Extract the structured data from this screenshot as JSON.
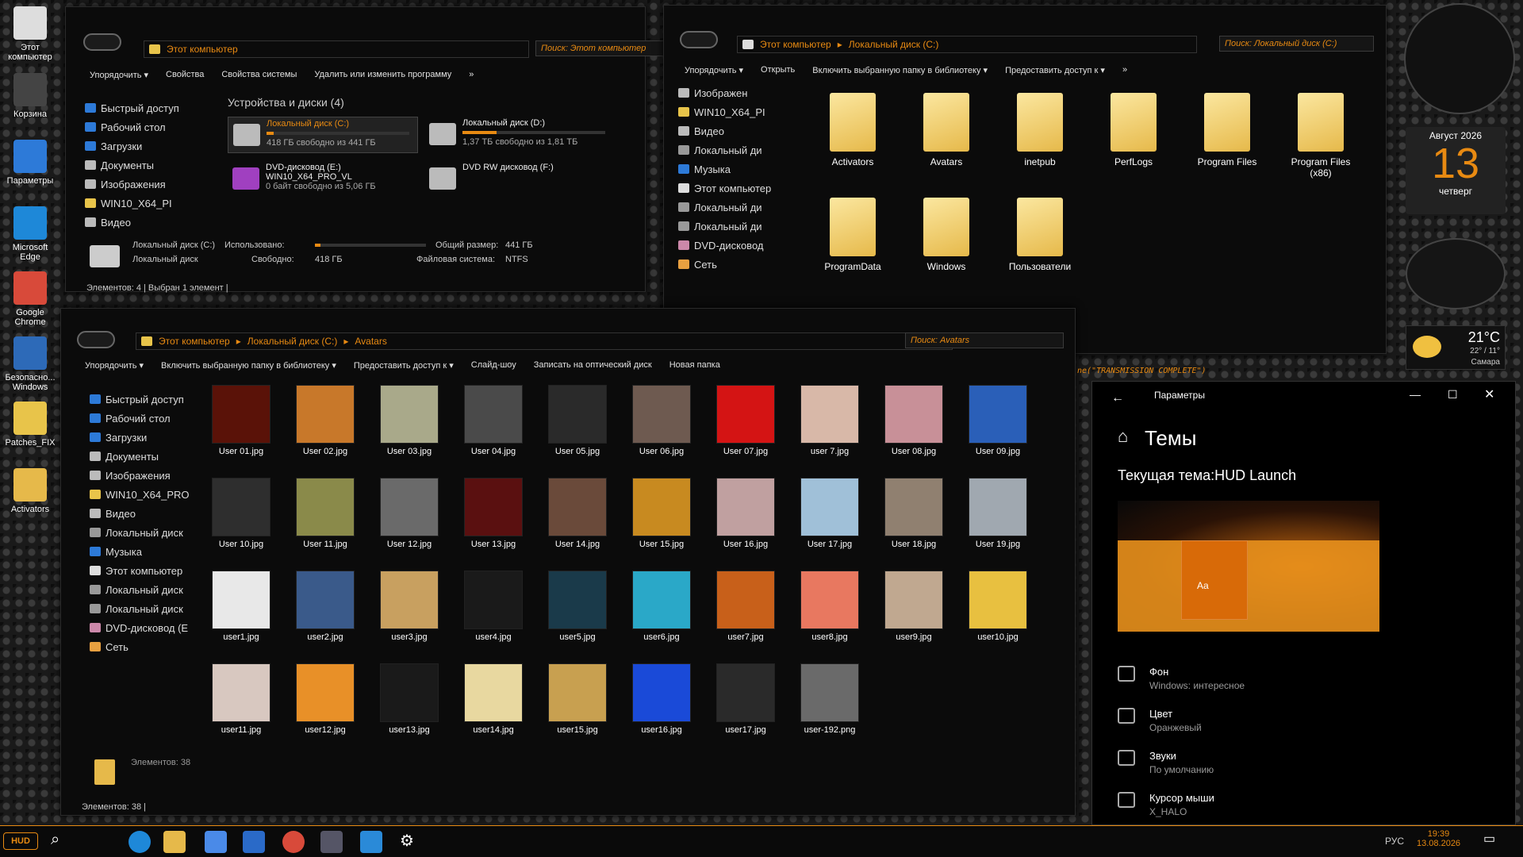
{
  "desktop_icons": [
    {
      "label": "Этот компьютер",
      "icon": "computer-icon"
    },
    {
      "label": "Корзина",
      "icon": "recycle-bin-icon"
    },
    {
      "label": "Параметры",
      "icon": "gear-icon"
    },
    {
      "label": "Microsoft Edge",
      "icon": "edge-icon"
    },
    {
      "label": "Google Chrome",
      "icon": "chrome-icon"
    },
    {
      "label": "Безопасно... Windows",
      "icon": "shield-icon"
    },
    {
      "label": "Patches_FIX",
      "icon": "folder-icon"
    },
    {
      "label": "Activators",
      "icon": "key-folder-icon"
    }
  ],
  "win1": {
    "breadcrumb": [
      "Этот компьютер"
    ],
    "search": "Поиск: Этот компьютер",
    "toolbar": [
      "Упорядочить ▾",
      "Свойства",
      "Свойства системы",
      "Удалить или изменить программу",
      "»"
    ],
    "nav": [
      {
        "label": "Быстрый доступ",
        "icon": "star-icon"
      },
      {
        "label": "Рабочий стол",
        "icon": "desktop-icon"
      },
      {
        "label": "Загрузки",
        "icon": "download-icon"
      },
      {
        "label": "Документы",
        "icon": "documents-icon"
      },
      {
        "label": "Изображения",
        "icon": "pictures-icon"
      },
      {
        "label": "WIN10_X64_PI",
        "icon": "folder-icon"
      },
      {
        "label": "Видео",
        "icon": "video-icon"
      }
    ],
    "group_title": "Устройства и диски (4)",
    "drives": [
      {
        "name": "Локальный диск (C:)",
        "free": "418 ГБ свободно из 441 ГБ",
        "used_fraction": 0.05,
        "selected": true
      },
      {
        "name": "Локальный диск (D:)",
        "free": "1,37 ТБ свободно из 1,81 ТБ",
        "used_fraction": 0.24
      },
      {
        "name": "DVD-дисковод (E:) WIN10_X64_PRO_VL",
        "free": "0 байт свободно из 5,06 ГБ"
      },
      {
        "name": "DVD RW дисковод (F:)",
        "free": ""
      }
    ],
    "details": {
      "name": "Локальный диск (C:)",
      "used_label": "Использовано:",
      "type": "Локальный диск",
      "free_label": "Свободно:",
      "free": "418 ГБ",
      "total_label": "Общий размер:",
      "total": "441 ГБ",
      "fs_label": "Файловая система:",
      "fs": "NTFS"
    },
    "status": "Элементов: 4  |  Выбран 1 элемент  |"
  },
  "win2": {
    "breadcrumb": [
      "Этот компьютер",
      "Локальный диск (C:)"
    ],
    "search": "Поиск: Локальный диск (C:)",
    "toolbar": [
      "Упорядочить ▾",
      "Открыть",
      "Включить выбранную папку в библиотеку ▾",
      "Предоставить доступ к ▾",
      "»"
    ],
    "nav": [
      {
        "label": "Изображен",
        "icon": "pictures-icon"
      },
      {
        "label": "WIN10_X64_PI",
        "icon": "folder-icon"
      },
      {
        "label": "Видео",
        "icon": "video-icon"
      },
      {
        "label": "Локальный ди",
        "icon": "drive-icon"
      },
      {
        "label": "Музыка",
        "icon": "music-icon"
      },
      {
        "label": "Этот компьютер",
        "icon": "computer-icon"
      },
      {
        "label": "Локальный ди",
        "icon": "drive-icon"
      },
      {
        "label": "Локальный ди",
        "icon": "drive-icon"
      },
      {
        "label": "DVD-дисковод",
        "icon": "dvd-icon"
      },
      {
        "label": "Сеть",
        "icon": "network-icon"
      }
    ],
    "folders": [
      "Activators",
      "Avatars",
      "inetpub",
      "PerfLogs",
      "Program Files",
      "Program Files (x86)",
      "ProgramData",
      "Windows",
      "Пользователи"
    ]
  },
  "win3": {
    "breadcrumb": [
      "Этот компьютер",
      "Локальный диск (C:)",
      "Avatars"
    ],
    "search": "Поиск: Avatars",
    "toolbar": [
      "Упорядочить ▾",
      "Включить выбранную папку в библиотеку ▾",
      "Предоставить доступ к ▾",
      "Слайд-шоу",
      "Записать на оптический диск",
      "Новая папка"
    ],
    "nav": [
      {
        "label": "Быстрый доступ",
        "icon": "star-icon"
      },
      {
        "label": "Рабочий стол",
        "icon": "desktop-icon"
      },
      {
        "label": "Загрузки",
        "icon": "download-icon"
      },
      {
        "label": "Документы",
        "icon": "documents-icon"
      },
      {
        "label": "Изображения",
        "icon": "pictures-icon"
      },
      {
        "label": "WIN10_X64_PRO",
        "icon": "folder-icon"
      },
      {
        "label": "Видео",
        "icon": "video-icon"
      },
      {
        "label": "Локальный диск",
        "icon": "drive-icon"
      },
      {
        "label": "Музыка",
        "icon": "music-icon"
      },
      {
        "label": "Этот компьютер",
        "icon": "computer-icon"
      },
      {
        "label": "Локальный диск",
        "icon": "drive-icon"
      },
      {
        "label": "Локальный диск",
        "icon": "drive-icon"
      },
      {
        "label": "DVD-дисковод (E",
        "icon": "dvd-icon"
      },
      {
        "label": "Сеть",
        "icon": "network-icon"
      }
    ],
    "files": [
      {
        "name": "User 01.jpg",
        "color": "#5a1208"
      },
      {
        "name": "User 02.jpg",
        "color": "#c8782a"
      },
      {
        "name": "User 03.jpg",
        "color": "#a9a98a"
      },
      {
        "name": "User 04.jpg",
        "color": "#4a4a4a"
      },
      {
        "name": "User 05.jpg",
        "color": "#2a2a2a"
      },
      {
        "name": "User 06.jpg",
        "color": "#6e5a50"
      },
      {
        "name": "User 07.jpg",
        "color": "#d41414"
      },
      {
        "name": "user 7.jpg",
        "color": "#d8b8a8"
      },
      {
        "name": "User 08.jpg",
        "color": "#c89098"
      },
      {
        "name": "User 09.jpg",
        "color": "#2a5fb8"
      },
      {
        "name": "User 10.jpg",
        "color": "#2e2e2e"
      },
      {
        "name": "User 11.jpg",
        "color": "#8a8a4a"
      },
      {
        "name": "User 12.jpg",
        "color": "#6a6a6a"
      },
      {
        "name": "User 13.jpg",
        "color": "#5a1010"
      },
      {
        "name": "User 14.jpg",
        "color": "#6a4a3a"
      },
      {
        "name": "User 15.jpg",
        "color": "#c88a20"
      },
      {
        "name": "User 16.jpg",
        "color": "#c0a0a0"
      },
      {
        "name": "User 17.jpg",
        "color": "#a0c0d8"
      },
      {
        "name": "User 18.jpg",
        "color": "#908070"
      },
      {
        "name": "User 19.jpg",
        "color": "#a0a8b0"
      },
      {
        "name": "user1.jpg",
        "color": "#e8e8e8"
      },
      {
        "name": "user2.jpg",
        "color": "#3a5a8a"
      },
      {
        "name": "user3.jpg",
        "color": "#c8a060"
      },
      {
        "name": "user4.jpg",
        "color": "#1a1a1a"
      },
      {
        "name": "user5.jpg",
        "color": "#1a3a4a"
      },
      {
        "name": "user6.jpg",
        "color": "#2aa8c8"
      },
      {
        "name": "user7.jpg",
        "color": "#c8601a"
      },
      {
        "name": "user8.jpg",
        "color": "#e87860"
      },
      {
        "name": "user9.jpg",
        "color": "#c0a890"
      },
      {
        "name": "user10.jpg",
        "color": "#e8c040"
      },
      {
        "name": "user11.jpg",
        "color": "#d8c8c0"
      },
      {
        "name": "user12.jpg",
        "color": "#e89028"
      },
      {
        "name": "user13.jpg",
        "color": "#1a1a1a"
      },
      {
        "name": "user14.jpg",
        "color": "#e8d8a0"
      },
      {
        "name": "user15.jpg",
        "color": "#c8a050"
      },
      {
        "name": "user16.jpg",
        "color": "#1a4ad8"
      },
      {
        "name": "user17.jpg",
        "color": "#2a2a2a"
      },
      {
        "name": "user-192.png",
        "color": "#6a6a6a"
      }
    ],
    "status_count": "Элементов: 38",
    "status": "Элементов: 38  |"
  },
  "settings": {
    "title": "Параметры",
    "heading": "Темы",
    "current_theme": "Текущая тема:HUD Launch",
    "preview_text": "Aa",
    "items": [
      {
        "title": "Фон",
        "subtitle": "Windows: интересное",
        "icon": "picture-icon"
      },
      {
        "title": "Цвет",
        "subtitle": "Оранжевый",
        "icon": "palette-icon"
      },
      {
        "title": "Звуки",
        "subtitle": "По умолчанию",
        "icon": "speaker-icon"
      },
      {
        "title": "Курсор мыши",
        "subtitle": "X_HALO",
        "icon": "cursor-icon"
      }
    ]
  },
  "widgets": {
    "calendar_month": "Август 2026",
    "calendar_day": "13",
    "calendar_weekday": "четверг",
    "weather_temp": "21°C",
    "weather_range": "22° / 11°",
    "weather_city": "Самара",
    "transmission_text": "ne(\"TRANSMISSION COMPLETE\")"
  },
  "taskbar": {
    "start_label": "HUD",
    "lang": "РУС",
    "time": "19:39",
    "date": "13.08.2026"
  },
  "colors": {
    "accent": "#e88a12",
    "background": "#0b0b0b"
  }
}
